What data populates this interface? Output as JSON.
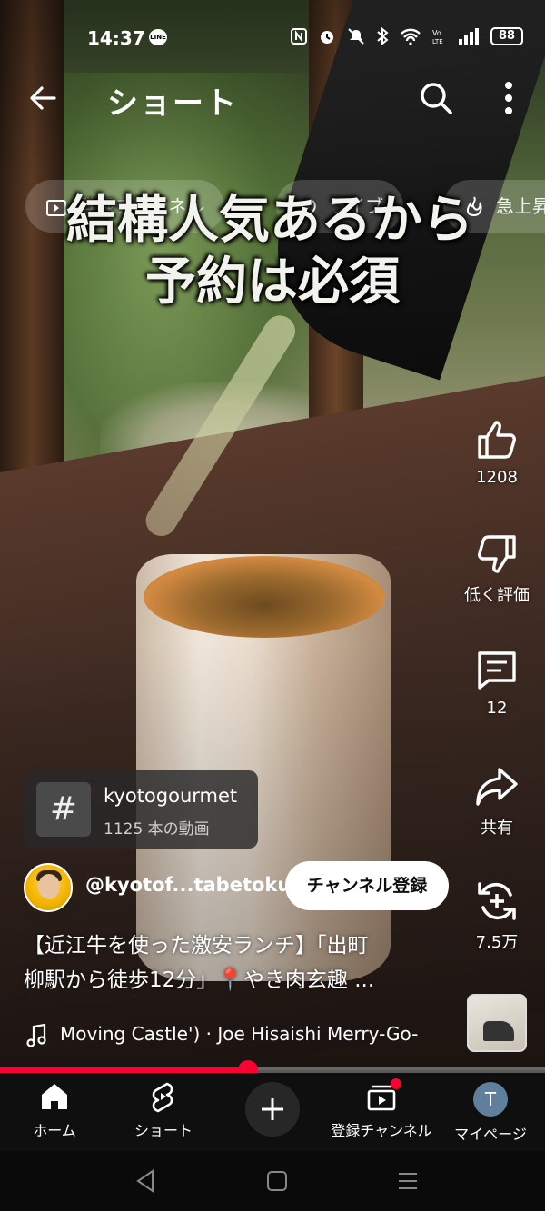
{
  "status_bar": {
    "time": "14:37",
    "line_badge": "LINE",
    "battery": "88"
  },
  "header": {
    "title": "ショート"
  },
  "chips": [
    {
      "label": "登録チャンネル",
      "icon": "subscriptions-icon"
    },
    {
      "label": "ライブ",
      "icon": "live-icon"
    },
    {
      "label": "急上昇",
      "icon": "trending-icon"
    }
  ],
  "caption": {
    "line1": "結構人気あるから",
    "line2": "予約は必須"
  },
  "actions": {
    "like_count": "1208",
    "dislike_label": "低く評価",
    "comments_count": "12",
    "share_label": "共有",
    "remix_count": "7.5万"
  },
  "hashtag": {
    "name": "kyotogourmet",
    "count": "1125 本の動画"
  },
  "channel": {
    "handle": "@kyotof...tabetoku",
    "subscribe_label": "チャンネル登録"
  },
  "description": {
    "line1": "【近江牛を使った激安ランチ】「出町",
    "line2": "柳駅から徒歩12分」📍やき肉玄趣 ..."
  },
  "music": {
    "track": "Moving Castle') · Joe Hisaishi     Merry-Go-"
  },
  "progress": {
    "played_fraction": 0.455
  },
  "nav": {
    "home": "ホーム",
    "shorts": "ショート",
    "subscriptions": "登録チャンネル",
    "you": "マイページ",
    "avatar_letter": "T"
  },
  "colors": {
    "accent_red": "#ff0033",
    "nav_bg": "#0f0f0f",
    "subscribe_bg": "#ffffff"
  }
}
